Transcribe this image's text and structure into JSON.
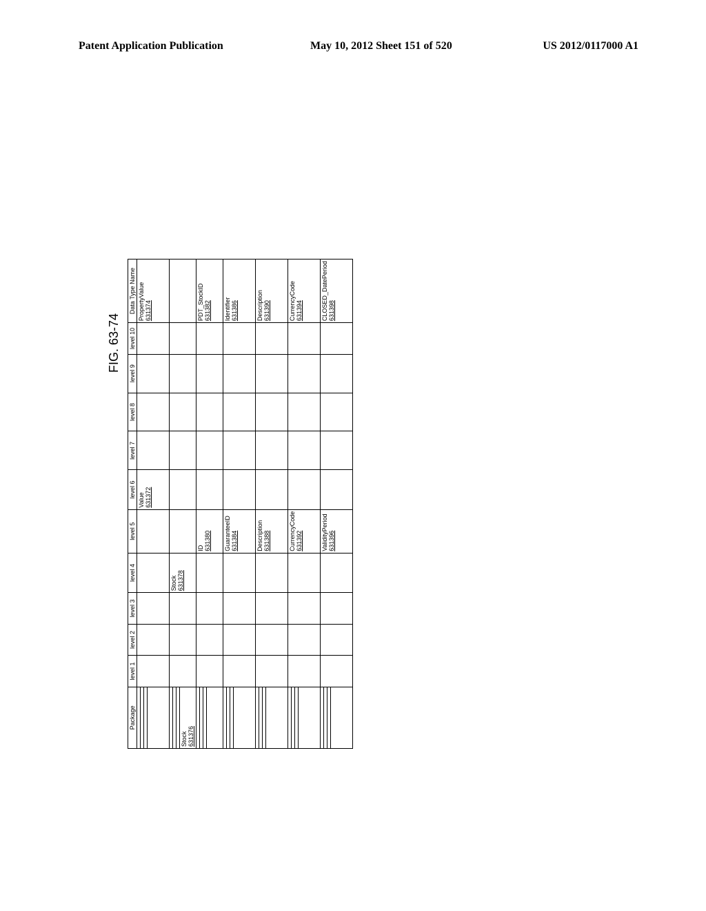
{
  "header": {
    "left": "Patent Application Publication",
    "center": "May 10, 2012  Sheet 151 of 520",
    "right": "US 2012/0117000 A1"
  },
  "figure_label": "FIG. 63-74",
  "columns": {
    "package": "Package",
    "level1": "level 1",
    "level2": "level 2",
    "level3": "level 3",
    "level4": "level 4",
    "level5": "level 5",
    "level6": "level 6",
    "level7": "level 7",
    "level8": "level 8",
    "level9": "level 9",
    "level10": "level 10",
    "datatype": "Data Type Name"
  },
  "rows": [
    {
      "package": "",
      "level4": "",
      "level5": "",
      "level6_label": "Value",
      "level6_ref": "631372",
      "datatype_label": "PropertyValue",
      "datatype_ref": "631374"
    },
    {
      "package_label": "Stock",
      "package_ref": "631376",
      "level4_label": "Stock",
      "level4_ref": "631378",
      "level5": "",
      "level6": "",
      "datatype": ""
    },
    {
      "package": "",
      "level4": "",
      "level5_label": "ID",
      "level5_ref": "631380",
      "level6": "",
      "datatype_label": "PDT_StockID",
      "datatype_ref": "631382"
    },
    {
      "package": "",
      "level4": "",
      "level5_label": "GuaranteeID",
      "level5_ref": "631384",
      "level6": "",
      "datatype_label": "Identifier",
      "datatype_ref": "631386"
    },
    {
      "package": "",
      "level4": "",
      "level5_label": "Description",
      "level5_ref": "631388",
      "level6": "",
      "datatype_label": "Description",
      "datatype_ref": "631390"
    },
    {
      "package": "",
      "level4": "",
      "level5_label": "CurrencyCode",
      "level5_ref": "631392",
      "level6": "",
      "datatype_label": "CurrencyCode",
      "datatype_ref": "631394"
    },
    {
      "package": "",
      "level4": "",
      "level5_label": "ValidityPeriod",
      "level5_ref": "631396",
      "level6": "",
      "datatype_label": "CLOSED_DatePeriod",
      "datatype_ref": "631398"
    }
  ]
}
